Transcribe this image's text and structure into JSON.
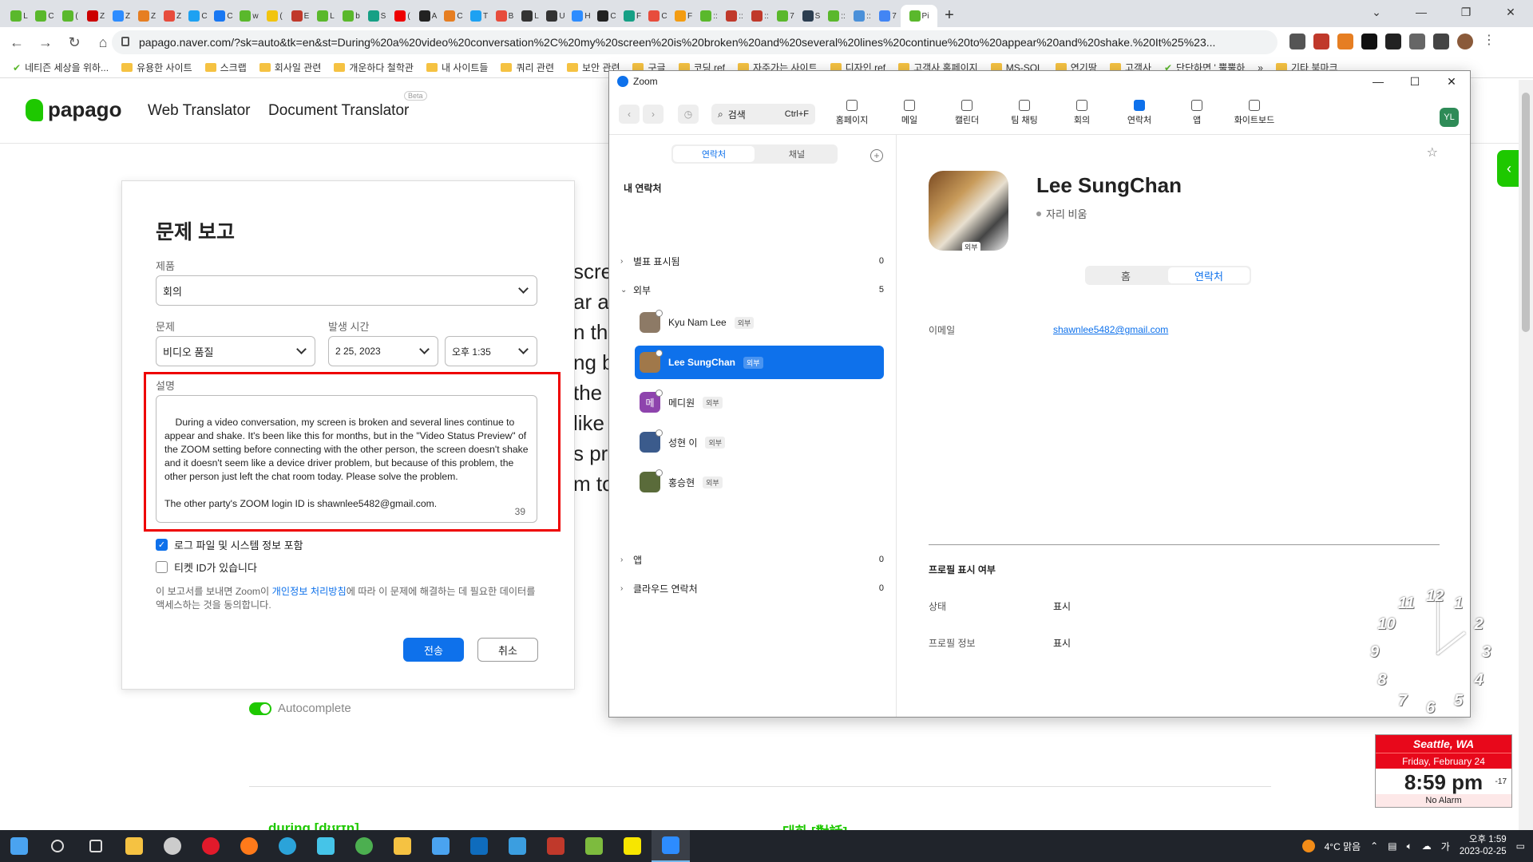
{
  "browser": {
    "tabs": [
      {
        "label": "L",
        "color": "#5ab82c"
      },
      {
        "label": "C",
        "color": "#5ab82c"
      },
      {
        "label": "(",
        "color": "#5ab82c"
      },
      {
        "label": "Z",
        "color": "#c00"
      },
      {
        "label": "Z",
        "color": "#2d8cff"
      },
      {
        "label": "Z",
        "color": "#e67e22"
      },
      {
        "label": "Z",
        "color": "#e74c3c"
      },
      {
        "label": "C",
        "color": "#1da1f2"
      },
      {
        "label": "C",
        "color": "#1877f2"
      },
      {
        "label": "w",
        "color": "#5ab82c"
      },
      {
        "label": "(",
        "color": "#f1c40f"
      },
      {
        "label": "E",
        "color": "#c0392b"
      },
      {
        "label": "L",
        "color": "#5ab82c"
      },
      {
        "label": "b",
        "color": "#5ab82c"
      },
      {
        "label": "S",
        "color": "#16a085"
      },
      {
        "label": "(",
        "color": "#e00"
      },
      {
        "label": "A",
        "color": "#222"
      },
      {
        "label": "C",
        "color": "#e67e22"
      },
      {
        "label": "T",
        "color": "#1da1f2"
      },
      {
        "label": "B",
        "color": "#e74c3c"
      },
      {
        "label": "L",
        "color": "#333"
      },
      {
        "label": "U",
        "color": "#333"
      },
      {
        "label": "H",
        "color": "#2d8cff"
      },
      {
        "label": "C",
        "color": "#222"
      },
      {
        "label": "F",
        "color": "#16a085"
      },
      {
        "label": "C",
        "color": "#e74c3c"
      },
      {
        "label": "F",
        "color": "#f39c12"
      },
      {
        "label": "::",
        "color": "#5ab82c"
      },
      {
        "label": "::",
        "color": "#c0392b"
      },
      {
        "label": "::",
        "color": "#c0392b"
      },
      {
        "label": "7",
        "color": "#5ab82c"
      },
      {
        "label": "S",
        "color": "#2c3e50"
      },
      {
        "label": "::",
        "color": "#5ab82c"
      },
      {
        "label": "::",
        "color": "#4a90d9"
      },
      {
        "label": "7",
        "color": "#4285f4"
      },
      {
        "label": "Pi",
        "color": "#5ab82c"
      }
    ],
    "new_tab": "+",
    "url": "papago.naver.com/?sk=auto&tk=en&st=During%20a%20video%20conversation%2C%20my%20screen%20is%20broken%20and%20several%20lines%20continue%20to%20appear%20and%20shake.%20It%25%23...",
    "bookmarks": [
      {
        "label": "네티즌 세상을 위하...",
        "type": "leaf"
      },
      {
        "label": "유용한 사이트",
        "type": "folder"
      },
      {
        "label": "스크랩",
        "type": "folder"
      },
      {
        "label": "회사일 관련",
        "type": "folder"
      },
      {
        "label": "개운하다 철학관",
        "type": "folder"
      },
      {
        "label": "내 사이트들",
        "type": "folder"
      },
      {
        "label": "쿼리 관련",
        "type": "folder"
      },
      {
        "label": "보안 관련",
        "type": "folder"
      },
      {
        "label": "구글",
        "type": "folder"
      },
      {
        "label": "코딩 ref",
        "type": "folder"
      },
      {
        "label": "자주가는 사이트",
        "type": "folder"
      },
      {
        "label": "디자인 ref",
        "type": "folder"
      },
      {
        "label": "고객사 홈페이지",
        "type": "folder"
      },
      {
        "label": "MS-SQL",
        "type": "folder"
      },
      {
        "label": "연기땅",
        "type": "folder"
      },
      {
        "label": "고객사",
        "type": "folder"
      },
      {
        "label": "단단하면 ' 뿔뿔하",
        "type": "leaf"
      },
      {
        "label": "»",
        "type": "none"
      },
      {
        "label": "기타 북마크",
        "type": "folder"
      }
    ]
  },
  "papago": {
    "logo": "papago",
    "nav_web": "Web Translator",
    "nav_doc": "Document Translator",
    "beta": "Beta",
    "bg_lines": [
      "scree",
      "ar a",
      "n th",
      "ng b",
      "the",
      "like",
      "s pr",
      "m to"
    ],
    "autocomplete": "Autocomplete",
    "dict_left": "during [dʊrɪŋ]",
    "dict_right": "대화 [對話]"
  },
  "report": {
    "title": "문제 보고",
    "product_label": "제품",
    "product_value": "회의",
    "issue_label": "문제",
    "issue_value": "비디오 품질",
    "time_label": "발생 시간",
    "date_value": "2  25, 2023",
    "time_value": "오후  1:35",
    "desc_label": "설명",
    "desc_text": "During a video conversation, my screen is broken and several lines continue to appear and shake. It's been like this for months, but in the \"Video Status Preview\" of the ZOOM setting before connecting with the other person, the screen doesn't shake and it doesn't seem like a device driver problem, but because of this problem, the other person just left the chat room today. Please solve the problem.\n\nThe other party's ZOOM login ID is shawnlee5482@gmail.com.",
    "desc_count": "39",
    "chk_logs": "로그 파일 및 시스템 정보 포함",
    "chk_ticket": "티켓 ID가 있습니다",
    "consent_pre": "이 보고서를 보내면 Zoom이 ",
    "consent_link": "개인정보 처리방침",
    "consent_post": "에 따라 이 문제에 해결하는 데 필요한 데이터를 액세스하는 것을 동의합니다.",
    "send": "전송",
    "cancel": "취소"
  },
  "zoom": {
    "title": "Zoom",
    "search": "검색",
    "search_kbd": "Ctrl+F",
    "toolbar": [
      "홈페이지",
      "메일",
      "캘린더",
      "팀 채팅",
      "회의",
      "연락처",
      "앱",
      "화이트보드"
    ],
    "avatar": "YL",
    "seg_contacts": "연락처",
    "seg_channels": "채널",
    "my_contacts": "내 연락처",
    "groups": {
      "starred": {
        "label": "별표 표시됨",
        "count": "0"
      },
      "external": {
        "label": "외부",
        "count": "5"
      },
      "apps": {
        "label": "앱",
        "count": "0"
      },
      "cloud": {
        "label": "클라우드 연락처",
        "count": "0"
      }
    },
    "ext_tag": "외부",
    "contacts": [
      {
        "name": "Kyu Nam Lee",
        "color": "#8d7a66",
        "initial": ""
      },
      {
        "name": "Lee SungChan",
        "color": "#a0784a",
        "initial": ""
      },
      {
        "name": "메디원",
        "color": "#8e44ad",
        "initial": "메"
      },
      {
        "name": "성현 이",
        "color": "#3b5b8c",
        "initial": ""
      },
      {
        "name": "홍승현",
        "color": "#5a6b3a",
        "initial": ""
      }
    ],
    "profile": {
      "name": "Lee SungChan",
      "status": "자리 비움",
      "photo_tag": "외부",
      "tab_home": "홈",
      "tab_contact": "연락처",
      "email_label": "이메일",
      "email": "shawnlee5482@gmail.com",
      "section": "프로필 표시 여부",
      "status_label": "상태",
      "status_value": "표시",
      "info_label": "프로필 정보",
      "info_value": "표시"
    }
  },
  "desktop": {
    "clock_numbers": [
      "12",
      "1",
      "2",
      "3",
      "4",
      "5",
      "6",
      "7",
      "8",
      "9",
      "10",
      "11"
    ],
    "weather_city": "Seattle, WA",
    "weather_date": "Friday, February 24",
    "weather_time": "8:59 pm",
    "weather_temp": "-17",
    "weather_alarm": "No Alarm"
  },
  "taskbar": {
    "apps": [
      {
        "name": "windows",
        "color": "#4aa3f0"
      },
      {
        "name": "search",
        "color": "#ddd"
      },
      {
        "name": "task-view",
        "color": "#ddd"
      },
      {
        "name": "pen",
        "color": "#f5c242"
      },
      {
        "name": "clock",
        "color": "#ccc"
      },
      {
        "name": "opera",
        "color": "#e21a2b"
      },
      {
        "name": "firefox",
        "color": "#ff7a1a"
      },
      {
        "name": "edge",
        "color": "#2ba3d9"
      },
      {
        "name": "bird",
        "color": "#45c4e8"
      },
      {
        "name": "chrome",
        "color": "#4caf50"
      },
      {
        "name": "explorer",
        "color": "#f5c242"
      },
      {
        "name": "store",
        "color": "#4aa3f0"
      },
      {
        "name": "outlook",
        "color": "#0f6cbd"
      },
      {
        "name": "mail",
        "color": "#3b9ee0"
      },
      {
        "name": "filezilla",
        "color": "#c0392b"
      },
      {
        "name": "notepad",
        "color": "#7dbb3e"
      },
      {
        "name": "kakaotalk",
        "color": "#f7e600"
      },
      {
        "name": "zoom",
        "color": "#2d8cff"
      }
    ],
    "weather": "4°C  맑음",
    "time": "오후 1:59",
    "date": "2023-02-25"
  }
}
